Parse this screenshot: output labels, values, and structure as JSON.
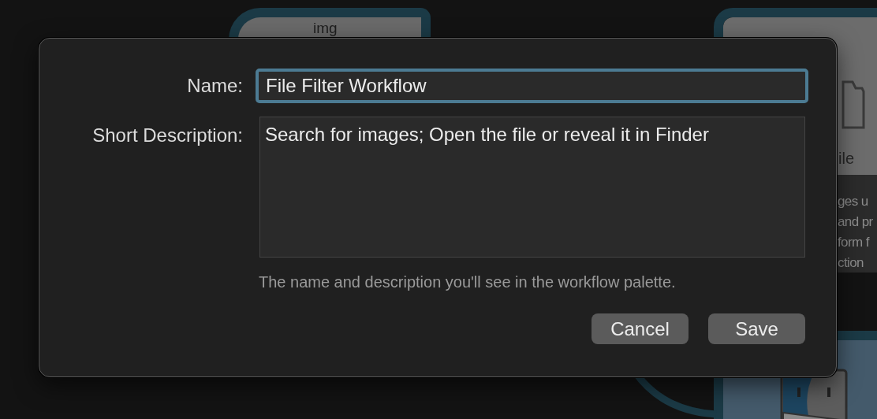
{
  "background": {
    "cards": [
      {
        "kind": "top",
        "title": "img"
      },
      {
        "kind": "side",
        "title": "ile",
        "description_lines": [
          "ges u",
          "and pr",
          "form f",
          "ction"
        ]
      },
      {
        "kind": "bottom"
      }
    ]
  },
  "dialog": {
    "fields": [
      {
        "kind": "input",
        "label": "Name:",
        "value": "File Filter Workflow",
        "focused": true
      },
      {
        "kind": "textarea",
        "label": "Short Description:",
        "value": "Search for images; Open the file or reveal it in Finder",
        "focused": false
      }
    ],
    "hint": "The name and description you'll see in the workflow palette.",
    "buttons": [
      {
        "label": "Cancel"
      },
      {
        "label": "Save"
      }
    ]
  }
}
